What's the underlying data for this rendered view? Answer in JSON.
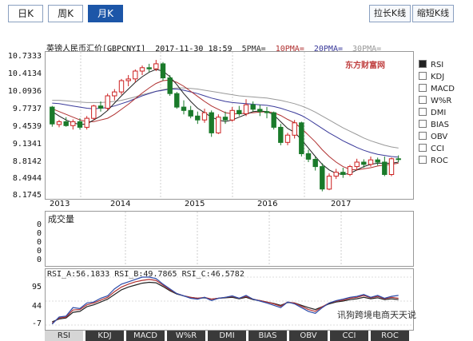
{
  "period_tabs": [
    "日K",
    "周K",
    "月K"
  ],
  "active_tab": 2,
  "buttons": {
    "stretch": "拉长K线",
    "shrink": "缩短K线"
  },
  "header": {
    "title": "英镑人民币汇价[GBPCNYI]",
    "datetime": "2017-11-30 18:59",
    "ma": [
      "5PMA=",
      "10PMA=",
      "20PMA=",
      "30PMA="
    ]
  },
  "y_axis": [
    "10.7333",
    "10.4134",
    "10.0936",
    "9.7737",
    "9.4539",
    "9.1341",
    "8.8142",
    "8.4944",
    "8.1745"
  ],
  "x_axis": [
    "2013",
    "2014",
    "2015",
    "2016",
    "2017"
  ],
  "volume": {
    "label": "成交量",
    "ticks": [
      "0",
      "0",
      "0",
      "0",
      "0",
      "0",
      "0"
    ]
  },
  "rsi": {
    "header": "RSI_A:56.1833 RSI_B:49.7865 RSI_C:46.5782",
    "ticks": [
      "95",
      "44",
      "-7"
    ]
  },
  "indicators": [
    "RSI",
    "KDJ",
    "MACD",
    "W%R",
    "DMI",
    "BIAS",
    "OBV",
    "CCI",
    "ROC"
  ],
  "selected_indicator": 0,
  "bottom_tabs": [
    "RSI",
    "KDJ",
    "MACD",
    "W%R",
    "DMI",
    "BIAS",
    "OBV",
    "CCI",
    "ROC"
  ],
  "logo_text": "东方财富网",
  "watermark": "讯狗跨境电商天天说",
  "colors": {
    "up": "#cc2020",
    "down": "#1a7a2a",
    "ma_red": "#b03030",
    "ma_dark": "#333333",
    "accent": "#1c56a8"
  },
  "chart_data": {
    "type": "candlestick",
    "ylim": [
      8.1745,
      10.7333
    ],
    "candles": [
      {
        "o": 9.78,
        "h": 9.8,
        "l": 9.43,
        "c": 9.48
      },
      {
        "o": 9.47,
        "h": 9.55,
        "l": 9.42,
        "c": 9.52
      },
      {
        "o": 9.52,
        "h": 9.6,
        "l": 9.43,
        "c": 9.45
      },
      {
        "o": 9.45,
        "h": 9.56,
        "l": 9.38,
        "c": 9.52
      },
      {
        "o": 9.52,
        "h": 9.58,
        "l": 9.38,
        "c": 9.42
      },
      {
        "o": 9.42,
        "h": 9.62,
        "l": 9.38,
        "c": 9.58
      },
      {
        "o": 9.58,
        "h": 9.82,
        "l": 9.55,
        "c": 9.8
      },
      {
        "o": 9.8,
        "h": 9.88,
        "l": 9.7,
        "c": 9.76
      },
      {
        "o": 9.76,
        "h": 10.02,
        "l": 9.72,
        "c": 9.98
      },
      {
        "o": 9.98,
        "h": 10.1,
        "l": 9.9,
        "c": 10.05
      },
      {
        "o": 10.05,
        "h": 10.28,
        "l": 10.0,
        "c": 10.25
      },
      {
        "o": 10.25,
        "h": 10.35,
        "l": 10.15,
        "c": 10.28
      },
      {
        "o": 10.28,
        "h": 10.45,
        "l": 10.22,
        "c": 10.42
      },
      {
        "o": 10.42,
        "h": 10.52,
        "l": 10.35,
        "c": 10.48
      },
      {
        "o": 10.48,
        "h": 10.55,
        "l": 10.4,
        "c": 10.46
      },
      {
        "o": 10.46,
        "h": 10.62,
        "l": 10.42,
        "c": 10.55
      },
      {
        "o": 10.55,
        "h": 10.58,
        "l": 10.25,
        "c": 10.3
      },
      {
        "o": 10.3,
        "h": 10.35,
        "l": 9.98,
        "c": 10.02
      },
      {
        "o": 10.02,
        "h": 10.05,
        "l": 9.75,
        "c": 9.78
      },
      {
        "o": 9.78,
        "h": 9.9,
        "l": 9.65,
        "c": 9.72
      },
      {
        "o": 9.72,
        "h": 9.8,
        "l": 9.58,
        "c": 9.62
      },
      {
        "o": 9.62,
        "h": 9.7,
        "l": 9.48,
        "c": 9.55
      },
      {
        "o": 9.55,
        "h": 9.75,
        "l": 9.5,
        "c": 9.68
      },
      {
        "o": 9.68,
        "h": 9.72,
        "l": 9.25,
        "c": 9.32
      },
      {
        "o": 9.32,
        "h": 9.65,
        "l": 9.3,
        "c": 9.6
      },
      {
        "o": 9.6,
        "h": 9.7,
        "l": 9.48,
        "c": 9.55
      },
      {
        "o": 9.55,
        "h": 9.78,
        "l": 9.52,
        "c": 9.72
      },
      {
        "o": 9.72,
        "h": 9.8,
        "l": 9.62,
        "c": 9.66
      },
      {
        "o": 9.66,
        "h": 9.92,
        "l": 9.62,
        "c": 9.82
      },
      {
        "o": 9.82,
        "h": 9.88,
        "l": 9.7,
        "c": 9.74
      },
      {
        "o": 9.74,
        "h": 9.82,
        "l": 9.62,
        "c": 9.7
      },
      {
        "o": 9.7,
        "h": 9.78,
        "l": 9.58,
        "c": 9.68
      },
      {
        "o": 9.68,
        "h": 9.7,
        "l": 9.38,
        "c": 9.42
      },
      {
        "o": 9.42,
        "h": 9.48,
        "l": 9.1,
        "c": 9.15
      },
      {
        "o": 9.15,
        "h": 9.32,
        "l": 9.1,
        "c": 9.28
      },
      {
        "o": 9.28,
        "h": 9.55,
        "l": 9.22,
        "c": 9.5
      },
      {
        "o": 9.5,
        "h": 9.52,
        "l": 8.9,
        "c": 8.95
      },
      {
        "o": 8.95,
        "h": 9.02,
        "l": 8.8,
        "c": 8.85
      },
      {
        "o": 8.85,
        "h": 8.9,
        "l": 8.65,
        "c": 8.72
      },
      {
        "o": 8.72,
        "h": 8.78,
        "l": 8.28,
        "c": 8.32
      },
      {
        "o": 8.32,
        "h": 8.6,
        "l": 8.3,
        "c": 8.55
      },
      {
        "o": 8.55,
        "h": 8.68,
        "l": 8.5,
        "c": 8.62
      },
      {
        "o": 8.62,
        "h": 8.7,
        "l": 8.52,
        "c": 8.58
      },
      {
        "o": 8.58,
        "h": 8.75,
        "l": 8.55,
        "c": 8.72
      },
      {
        "o": 8.72,
        "h": 8.86,
        "l": 8.65,
        "c": 8.8
      },
      {
        "o": 8.8,
        "h": 8.85,
        "l": 8.7,
        "c": 8.76
      },
      {
        "o": 8.76,
        "h": 8.9,
        "l": 8.72,
        "c": 8.84
      },
      {
        "o": 8.84,
        "h": 8.88,
        "l": 8.74,
        "c": 8.8
      },
      {
        "o": 8.8,
        "h": 8.9,
        "l": 8.55,
        "c": 8.58
      },
      {
        "o": 8.58,
        "h": 8.88,
        "l": 8.55,
        "c": 8.86
      },
      {
        "o": 8.86,
        "h": 8.92,
        "l": 8.8,
        "c": 8.85
      }
    ],
    "ma_short": [
      9.7,
      9.62,
      9.55,
      9.5,
      9.47,
      9.48,
      9.55,
      9.62,
      9.72,
      9.85,
      9.98,
      10.1,
      10.22,
      10.32,
      10.4,
      10.45,
      10.42,
      10.32,
      10.18,
      10.02,
      9.88,
      9.76,
      9.68,
      9.6,
      9.55,
      9.52,
      9.55,
      9.6,
      9.65,
      9.7,
      9.71,
      9.7,
      9.64,
      9.52,
      9.4,
      9.33,
      9.2,
      9.05,
      8.9,
      8.76,
      8.66,
      8.6,
      8.58,
      8.6,
      8.66,
      8.72,
      8.76,
      8.78,
      8.78,
      8.78,
      8.8
    ],
    "ma_mid": [
      9.75,
      9.7,
      9.65,
      9.6,
      9.55,
      9.52,
      9.52,
      9.55,
      9.58,
      9.65,
      9.74,
      9.83,
      9.93,
      10.03,
      10.12,
      10.2,
      10.25,
      10.26,
      10.22,
      10.15,
      10.06,
      9.97,
      9.88,
      9.8,
      9.74,
      9.68,
      9.66,
      9.66,
      9.67,
      9.68,
      9.69,
      9.7,
      9.68,
      9.63,
      9.56,
      9.5,
      9.4,
      9.28,
      9.16,
      9.02,
      8.9,
      8.8,
      8.72,
      8.67,
      8.66,
      8.68,
      8.7,
      8.73,
      8.75,
      8.76,
      8.78
    ],
    "ma_long": [
      9.85,
      9.84,
      9.82,
      9.8,
      9.78,
      9.76,
      9.75,
      9.76,
      9.77,
      9.8,
      9.84,
      9.88,
      9.93,
      9.98,
      10.02,
      10.06,
      10.08,
      10.1,
      10.1,
      10.08,
      10.05,
      10.02,
      9.98,
      9.94,
      9.91,
      9.88,
      9.86,
      9.85,
      9.84,
      9.83,
      9.82,
      9.81,
      9.79,
      9.76,
      9.72,
      9.68,
      9.63,
      9.56,
      9.48,
      9.4,
      9.32,
      9.25,
      9.18,
      9.12,
      9.06,
      9.01,
      8.97,
      8.94,
      8.92,
      8.9,
      8.89
    ],
    "ma_long2": [
      9.9,
      9.9,
      9.89,
      9.88,
      9.87,
      9.86,
      9.86,
      9.86,
      9.87,
      9.88,
      9.9,
      9.93,
      9.96,
      10.0,
      10.03,
      10.06,
      10.09,
      10.11,
      10.12,
      10.12,
      10.11,
      10.1,
      10.08,
      10.06,
      10.04,
      10.02,
      10.0,
      9.98,
      9.97,
      9.96,
      9.95,
      9.94,
      9.92,
      9.9,
      9.87,
      9.84,
      9.8,
      9.75,
      9.69,
      9.62,
      9.55,
      9.48,
      9.41,
      9.35,
      9.29,
      9.23,
      9.18,
      9.14,
      9.1,
      9.07,
      9.05
    ],
    "rsi_a": [
      -5,
      10,
      12,
      30,
      28,
      40,
      42,
      50,
      55,
      70,
      80,
      85,
      90,
      95,
      95,
      92,
      80,
      70,
      60,
      55,
      50,
      48,
      52,
      45,
      50,
      52,
      55,
      50,
      56,
      48,
      44,
      40,
      35,
      30,
      42,
      38,
      30,
      22,
      18,
      30,
      40,
      45,
      48,
      52,
      54,
      58,
      52,
      56,
      50,
      54,
      56
    ],
    "rsi_b": [
      -3,
      8,
      10,
      25,
      26,
      36,
      40,
      46,
      52,
      64,
      74,
      80,
      85,
      88,
      90,
      88,
      78,
      68,
      60,
      55,
      52,
      50,
      52,
      48,
      50,
      52,
      54,
      50,
      54,
      48,
      45,
      42,
      38,
      33,
      42,
      40,
      33,
      26,
      22,
      32,
      40,
      44,
      46,
      50,
      52,
      56,
      51,
      54,
      49,
      52,
      50
    ],
    "rsi_c": [
      0,
      6,
      8,
      20,
      22,
      32,
      36,
      42,
      48,
      58,
      68,
      74,
      78,
      82,
      84,
      83,
      75,
      66,
      59,
      55,
      52,
      50,
      51,
      48,
      50,
      51,
      52,
      49,
      52,
      47,
      45,
      42,
      39,
      35,
      41,
      40,
      35,
      30,
      26,
      32,
      38,
      42,
      44,
      47,
      49,
      52,
      49,
      51,
      47,
      49,
      47
    ]
  }
}
